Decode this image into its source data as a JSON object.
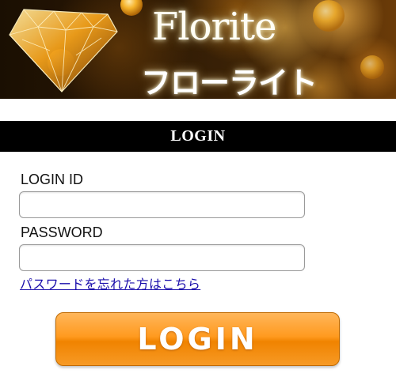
{
  "banner": {
    "title_en": "Florite",
    "title_jp": "フローライト",
    "image": "florite-crystal-banner"
  },
  "login_bar": {
    "title": "LOGIN"
  },
  "form": {
    "login_id_label": "LOGIN ID",
    "login_id_value": "",
    "password_label": "PASSWORD",
    "password_value": "",
    "forgot_password_link": "パスワードを忘れた方はこちら"
  },
  "login_button": {
    "label": "LOGIN"
  },
  "colors": {
    "header_bar": "#000000",
    "button_orange": "#ff9a1f",
    "link_blue": "#1a0dab"
  }
}
